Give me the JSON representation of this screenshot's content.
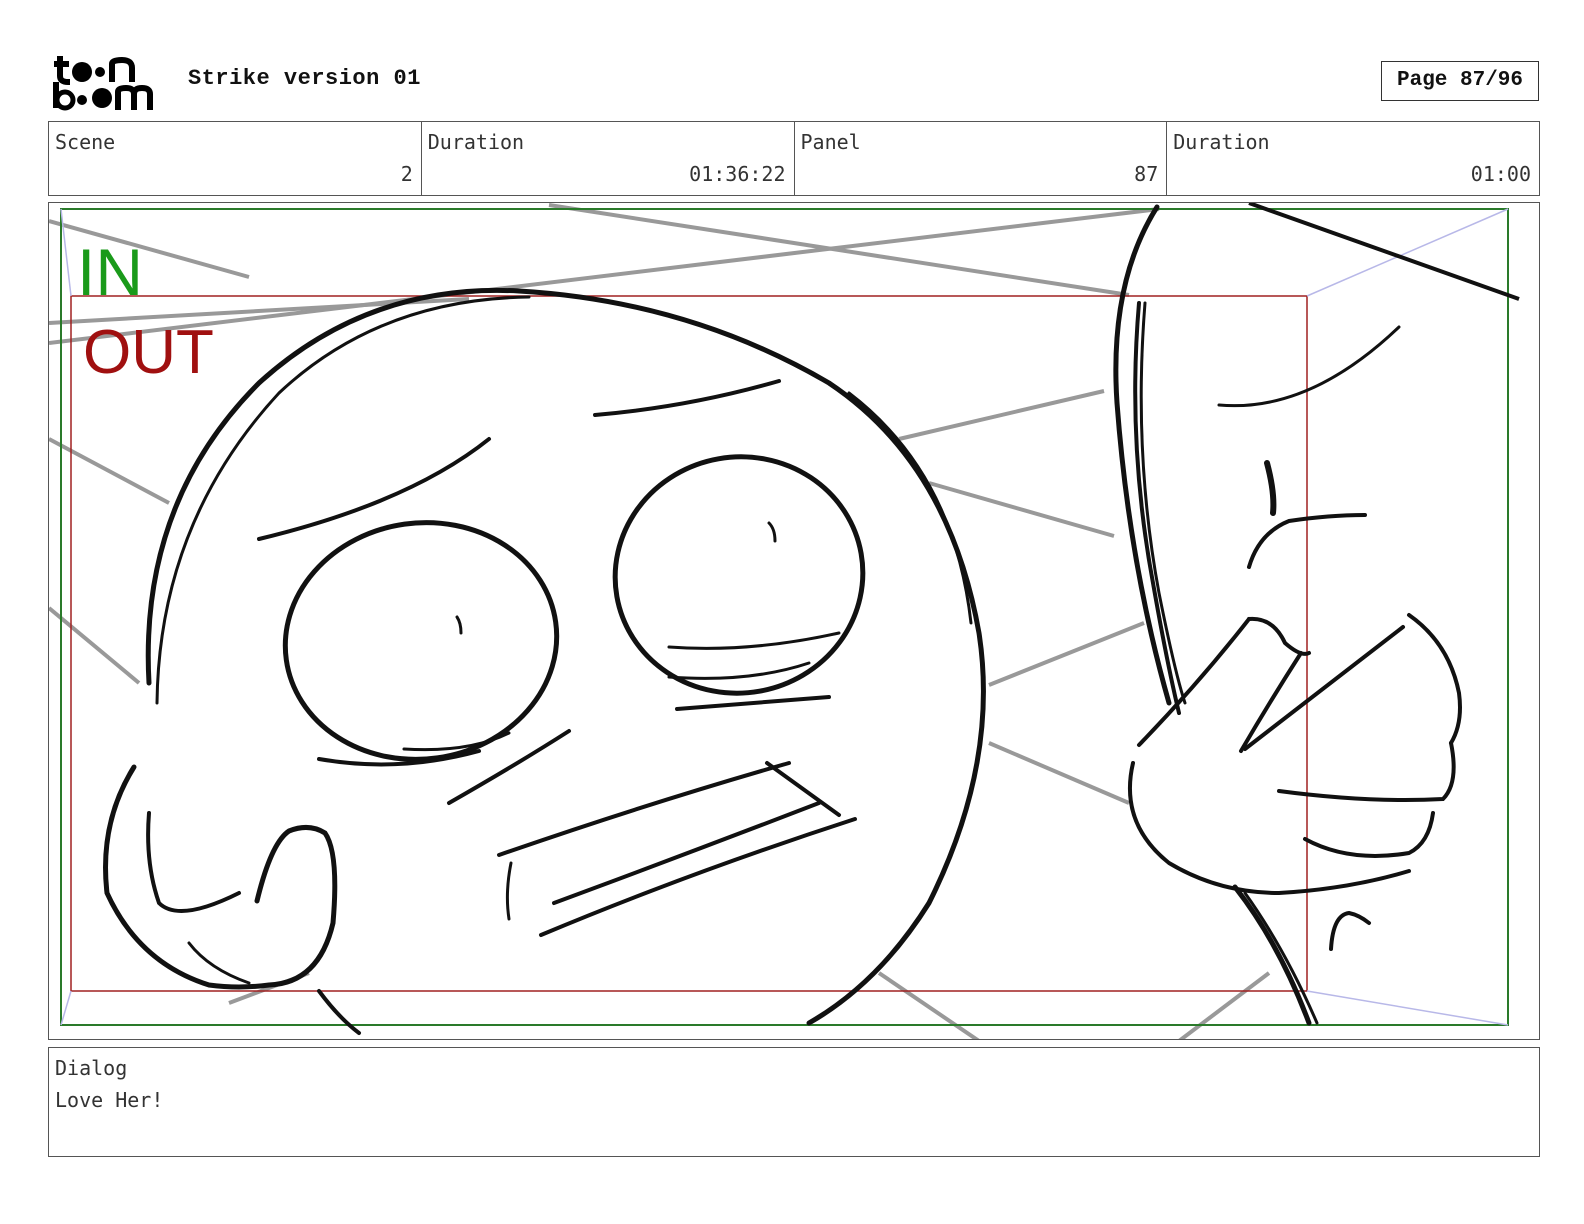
{
  "header": {
    "logo_text": "toon boom",
    "title": "Strike version 01",
    "page": "Page 87/96"
  },
  "info": {
    "scene_label": "Scene",
    "scene_value": "2",
    "scene_duration_label": "Duration",
    "scene_duration_value": "01:36:22",
    "panel_label": "Panel",
    "panel_value": "87",
    "panel_duration_label": "Duration",
    "panel_duration_value": "01:00"
  },
  "panel": {
    "in_label": "IN",
    "out_label": "OUT",
    "in_color": "#1a9a1a",
    "out_color": "#a01010"
  },
  "dialog": {
    "label": "Dialog",
    "text": "Love Her!"
  }
}
